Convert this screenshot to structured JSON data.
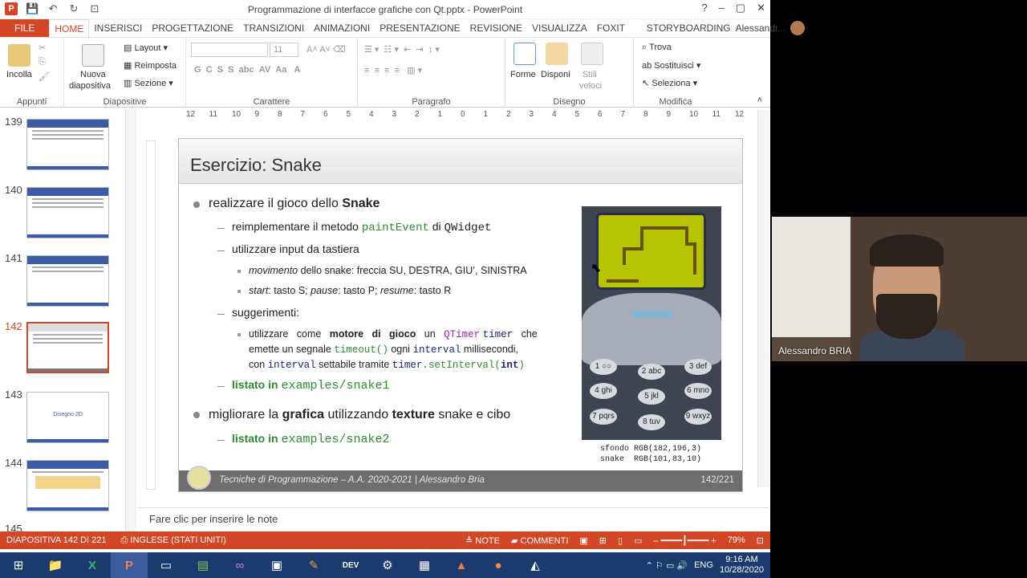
{
  "window": {
    "title": "Programmazione di interfacce grafiche con Qt.pptx - PowerPoint",
    "help": "?",
    "controls": [
      "–",
      "▢",
      "✕"
    ]
  },
  "tabs": [
    "FILE",
    "HOME",
    "INSERISCI",
    "PROGETTAZIONE",
    "TRANSIZIONI",
    "ANIMAZIONI",
    "PRESENTAZIONE",
    "REVISIONE",
    "VISUALIZZA",
    "FOXIT READER PDF",
    "STORYBOARDING"
  ],
  "user": "Alessandr...",
  "ribbon": {
    "appunti": {
      "label": "Appunti",
      "paste": "Incolla"
    },
    "diapositive": {
      "label": "Diapositive",
      "new_slide_1": "Nuova",
      "new_slide_2": "diapositiva",
      "layout": "Layout",
      "reset": "Reimposta",
      "section": "Sezione"
    },
    "carattere": {
      "label": "Carattere",
      "font_size": "11"
    },
    "paragrafo": {
      "label": "Paragrafo"
    },
    "disegno": {
      "label": "Disegno",
      "shapes": "Forme",
      "arrange": "Disponi",
      "styles_1": "Stili",
      "styles_2": "veloci"
    },
    "modifica": {
      "label": "Modifica",
      "find": "Trova",
      "replace": "Sostituisci",
      "select": "Seleziona"
    }
  },
  "thumbnails": [
    {
      "num": "139"
    },
    {
      "num": "140"
    },
    {
      "num": "141"
    },
    {
      "num": "142",
      "selected": true
    },
    {
      "num": "143",
      "title": "Disegno 2D"
    },
    {
      "num": "144"
    },
    {
      "num": "145"
    }
  ],
  "ruler": [
    "12",
    "11",
    "10",
    "9",
    "8",
    "7",
    "6",
    "5",
    "4",
    "3",
    "2",
    "1",
    "0",
    "1",
    "2",
    "3",
    "4",
    "5",
    "6",
    "7",
    "8",
    "9",
    "10",
    "11",
    "12"
  ],
  "slide": {
    "title": "Esercizio: Snake",
    "b1_a_pre": "realizzare il gioco dello ",
    "b1_a_bold": "Snake",
    "b2_1_pre": "reimplementare il metodo ",
    "b2_1_code": "paintEvent",
    "b2_1_mid": " di ",
    "b2_1_code2": "QWidget",
    "b2_2": "utilizzare input da tastiera",
    "b3_1_it": "movimento",
    "b3_1_rest": " dello snake: freccia SU, DESTRA, GIU’, SINISTRA",
    "b3_2_it1": "start",
    "b3_2_t1": ": tasto S; ",
    "b3_2_it2": "pause",
    "b3_2_t2": ": tasto P; ",
    "b3_2_it3": "resume",
    "b3_2_t3": ": tasto R",
    "b2_3": "suggerimenti:",
    "b3_3_l1_a": "utilizzare   come   ",
    "b3_3_l1_b": "motore   di   gioco",
    "b3_3_l1_c": "   un   ",
    "b3_3_l1_d": "QTimer",
    "b3_3_l1_e": " ",
    "b3_3_l1_f": "timer",
    "b3_3_l1_g": "   che",
    "b3_3_l2_a": "emette un segnale ",
    "b3_3_l2_b": "timeout()",
    "b3_3_l2_c": " ogni ",
    "b3_3_l2_d": "interval",
    "b3_3_l2_e": " millisecondi,",
    "b3_3_l3_a": "con ",
    "b3_3_l3_b": "interval",
    "b3_3_l3_c": " settabile tramite ",
    "b3_3_l3_d": "timer",
    "b3_3_l3_e": ".setInterval(",
    "b3_3_l3_f": "int",
    "b3_3_l3_g": ")",
    "listato1_a": "listato in ",
    "listato1_b": "examples/snake1",
    "b1_b_pre": "migliorare la ",
    "b1_b_bold1": "grafica",
    "b1_b_mid": " utilizzando ",
    "b1_b_bold2": "texture",
    "b1_b_end": " snake e cibo",
    "listato2_a": "listato in ",
    "listato2_b": "examples/snake2",
    "caption_1": "sfondo RGB(182,196,3)",
    "caption_2": "snake  RGB(101,83,10)",
    "footer": "Tecniche di Programmazione – A.A. 2020-2021 | Alessandro Bria",
    "page": "142/221",
    "keys": [
      "1 ○○",
      "2 abc",
      "3 def",
      "4 ghi",
      "5 jkl",
      "6 mno",
      "7 pqrs",
      "8 tuv",
      "9 wxyz"
    ]
  },
  "notes_placeholder": "Fare clic per inserire le note",
  "status": {
    "slide": "DIAPOSITIVA 142 DI 221",
    "lang": "INGLESE (STATI UNITI)",
    "notes": "NOTE",
    "comments": "COMMENTI",
    "zoom": "79%"
  },
  "taskbar": {
    "lang": "ENG",
    "time": "9:16 AM",
    "date": "10/28/2020"
  },
  "webcam": {
    "name": "Alessandro BRIA"
  },
  "colors": {
    "accent": "#d24726",
    "screen": "#b6c403",
    "snake": "#65530a"
  }
}
